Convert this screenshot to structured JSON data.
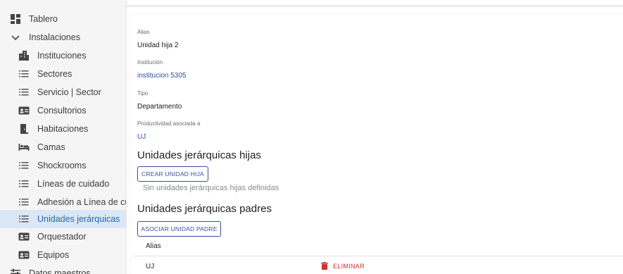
{
  "sidebar": {
    "items": [
      {
        "label": "Tablero",
        "icon": "dashboard-icon"
      },
      {
        "label": "Instalaciones",
        "icon": "chevron-down-icon"
      },
      {
        "label": "Instituciones",
        "icon": "building-icon"
      },
      {
        "label": "Sectores",
        "icon": "list-icon"
      },
      {
        "label": "Servicio | Sector",
        "icon": "list-icon"
      },
      {
        "label": "Consultorios",
        "icon": "id-card-icon"
      },
      {
        "label": "Habitaciones",
        "icon": "door-icon"
      },
      {
        "label": "Camas",
        "icon": "bed-icon"
      },
      {
        "label": "Shockrooms",
        "icon": "list-icon"
      },
      {
        "label": "Líneas de cuidado",
        "icon": "list-icon"
      },
      {
        "label": "Adhesión a Línea de cuidado",
        "icon": "list-icon"
      },
      {
        "label": "Unidades jerárquicas",
        "icon": "list-icon"
      },
      {
        "label": "Orquestador",
        "icon": "id-card-icon"
      },
      {
        "label": "Equipos",
        "icon": "id-card-icon"
      },
      {
        "label": "Datos maestros",
        "icon": "tune-icon"
      }
    ],
    "active_color": "#2563b8"
  },
  "detail": {
    "alias_label": "Alias",
    "alias_value": "Unidad hija 2",
    "institution_label": "Institución",
    "institution_value": "institucion 5305",
    "type_label": "Tipo",
    "type_value": "Departamento",
    "productivity_label": "Productividad asociada a",
    "productivity_value": "UJ"
  },
  "children": {
    "title": "Unidades jerárquicas hijas",
    "create_button": "CREAR UNIDAD HIJA",
    "empty_message": "Sin unidades jerárquicas hijas definidas"
  },
  "parents": {
    "title": "Unidades jerárquicas padres",
    "associate_button": "ASOCIAR UNIDAD PADRE",
    "table_header_alias": "Alias",
    "rows": [
      {
        "alias": "UJ",
        "delete_label": "ELIMINAR"
      }
    ]
  }
}
